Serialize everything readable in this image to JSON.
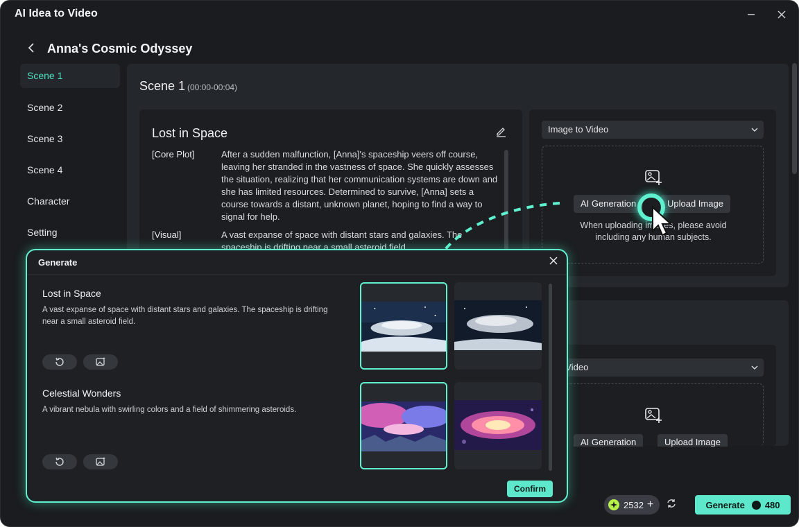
{
  "app": {
    "title": "AI Idea to Video"
  },
  "project": {
    "title": "Anna's Cosmic Odyssey"
  },
  "sidebar": {
    "items": [
      {
        "label": "Scene 1"
      },
      {
        "label": "Scene 2"
      },
      {
        "label": "Scene 3"
      },
      {
        "label": "Scene 4"
      },
      {
        "label": "Character"
      },
      {
        "label": "Setting"
      }
    ]
  },
  "scene": {
    "title": "Scene 1",
    "time": "(00:00-00:04)",
    "card_title": "Lost in Space",
    "core_plot_label": "[Core Plot]",
    "core_plot_text": "After a sudden malfunction, [Anna]'s spaceship veers off course, leaving her stranded in the vastness of space. She quickly assesses the situation, realizing that her communication systems are down and she has limited resources. Determined to survive, [Anna] sets a course towards a distant, unknown planet, hoping to find a way to signal for help.",
    "visual_label": "[Visual]",
    "visual_text": "A vast expanse of space with distant stars and galaxies. The spaceship is drifting near a small asteroid field."
  },
  "image_panel": {
    "mode": "Image to Video",
    "mode2": "e to Video",
    "ai_generation": "AI Generation",
    "upload_image": "Upload Image",
    "note": "When uploading images, please avoid including any human subjects."
  },
  "footer": {
    "credits": "2532",
    "generate_label": "Generate",
    "generate_cost": "480"
  },
  "dialog": {
    "title": "Generate",
    "items": [
      {
        "title": "Lost in Space",
        "desc": "A vast expanse of space with distant stars and galaxies. The spaceship is drifting near a small asteroid field."
      },
      {
        "title": "Celestial Wonders",
        "desc": "A vibrant nebula with swirling colors and a field of shimmering asteroids."
      }
    ],
    "confirm_label": "Confirm"
  },
  "colors": {
    "accent": "#5ee8cb",
    "background": "#1a1c1f",
    "panel": "#24272b"
  }
}
